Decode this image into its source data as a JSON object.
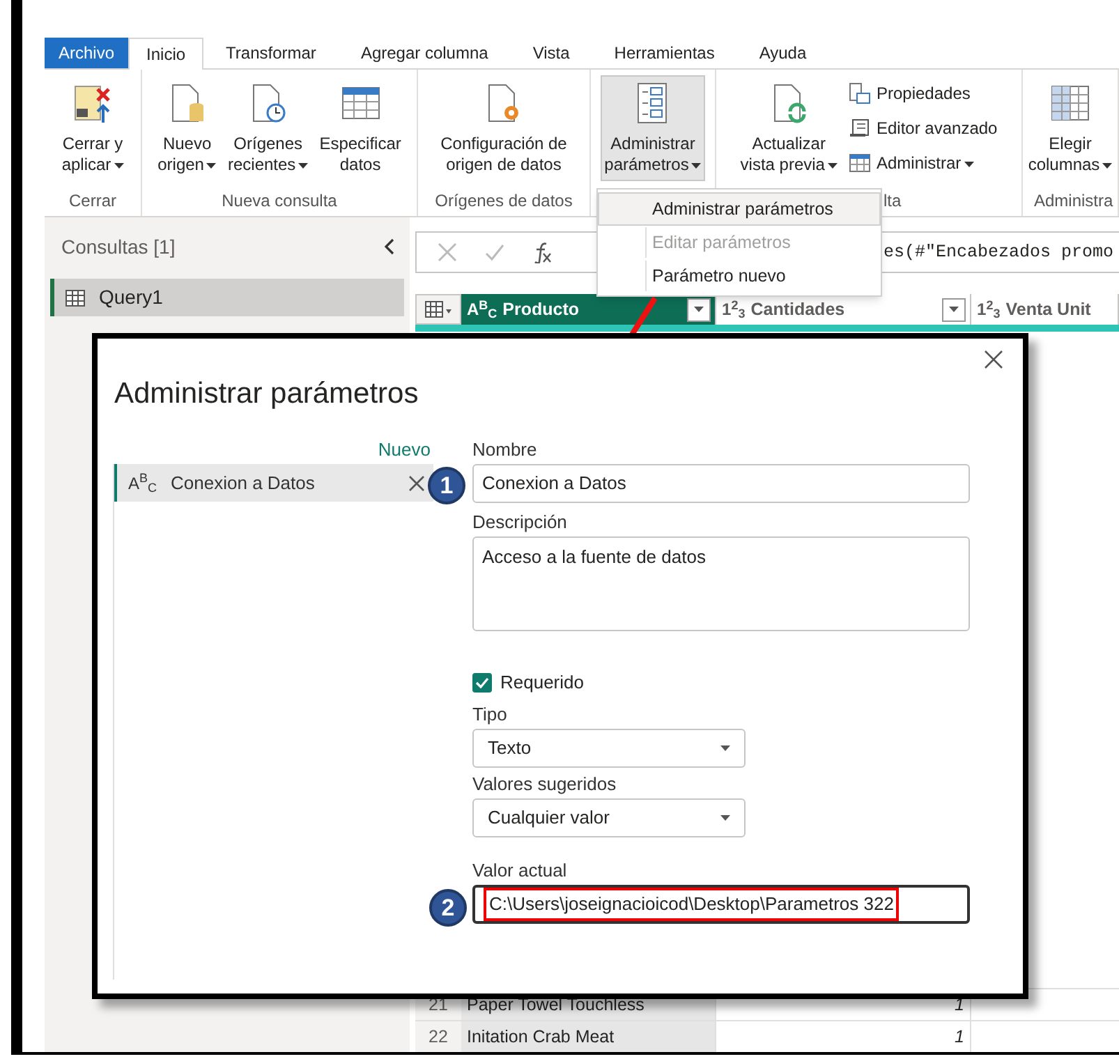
{
  "tabs": [
    {
      "label": "Archivo",
      "kind": "file",
      "selected": false
    },
    {
      "label": "Inicio",
      "kind": "tab",
      "selected": true
    },
    {
      "label": "Transformar",
      "kind": "tab",
      "selected": false
    },
    {
      "label": "Agregar columna",
      "kind": "tab",
      "selected": false
    },
    {
      "label": "Vista",
      "kind": "tab",
      "selected": false
    },
    {
      "label": "Herramientas",
      "kind": "tab",
      "selected": false
    },
    {
      "label": "Ayuda",
      "kind": "tab",
      "selected": false
    }
  ],
  "ribbon": {
    "groups": [
      {
        "label": "Cerrar",
        "buttons": [
          {
            "kind": "large",
            "label": "Cerrar y\naplicar",
            "caret": true,
            "pressed": false
          }
        ]
      },
      {
        "label": "Nueva consulta",
        "buttons": [
          {
            "kind": "large",
            "label": "Nuevo\norigen",
            "caret": true,
            "pressed": false
          },
          {
            "kind": "large",
            "label": "Orígenes\nrecientes",
            "caret": true,
            "pressed": false
          },
          {
            "kind": "large",
            "label": "Especificar\ndatos",
            "caret": false,
            "pressed": false
          }
        ]
      },
      {
        "label": "Orígenes de datos",
        "buttons": [
          {
            "kind": "large",
            "label": "Configuración de\norigen de datos",
            "caret": false,
            "pressed": false
          }
        ]
      },
      {
        "buttons": [
          {
            "kind": "large",
            "label": "Administrar\nparámetros",
            "caret": true,
            "pressed": true
          }
        ]
      },
      {
        "label": "lta",
        "buttons": [
          {
            "kind": "large",
            "label": "Actualizar\nvista previa",
            "caret": true,
            "pressed": false
          },
          {
            "kind": "small",
            "label": "Propiedades",
            "caret": false,
            "pressed": false
          },
          {
            "kind": "small",
            "label": "Editor avanzado",
            "caret": false,
            "pressed": false
          },
          {
            "kind": "small",
            "label": "Administrar",
            "caret": true,
            "pressed": false
          }
        ]
      },
      {
        "label": "Administra",
        "buttons": [
          {
            "kind": "large",
            "label": "Elegir\ncolumnas",
            "caret": true,
            "pressed": false
          }
        ]
      }
    ]
  },
  "queries_pane": {
    "title": "Consultas [1]",
    "items": [
      {
        "name": "Query1",
        "selected": true
      }
    ]
  },
  "formula_bar": {
    "text": "es(#\"Encabezados promo"
  },
  "table": {
    "columns": [
      {
        "type_label": "A$^{B}$$_{C}$",
        "name": "Producto",
        "selected": true
      },
      {
        "type_label": "1$^{2}$$_{3}$",
        "name": "Cantidades",
        "selected": false
      },
      {
        "type_label": "1$^{2}$$_{3}$",
        "name": "Venta Unit",
        "selected": false
      }
    ],
    "rows": [
      {
        "number": "21",
        "cells": [
          "Paper Towel Touchless",
          "1"
        ]
      },
      {
        "number": "22",
        "cells": [
          "Initation Crab Meat",
          "1"
        ]
      }
    ]
  },
  "menu": {
    "items": [
      {
        "label": "Administrar parámetros",
        "selected": true,
        "disabled": false
      },
      {
        "label": "Editar parámetros",
        "selected": false,
        "disabled": true
      },
      {
        "label": "Parámetro nuevo",
        "selected": false,
        "disabled": false
      }
    ]
  },
  "dialog": {
    "title": "Administrar parámetros",
    "new_link": "Nuevo",
    "parameters": [
      {
        "type_label": "A$^{B}$$_{C}$",
        "name": "Conexion a Datos",
        "selected": true
      }
    ],
    "fields": [
      {
        "kind": "text",
        "label": "Nombre",
        "value": "Conexion a Datos",
        "badge": "1",
        "highlighted": false
      },
      {
        "kind": "textarea",
        "label": "Descripción",
        "value": "Acceso a la fuente de datos"
      },
      {
        "kind": "checkbox",
        "label": "Requerido",
        "checked": true
      },
      {
        "kind": "select",
        "label": "Tipo",
        "value": "Texto"
      },
      {
        "kind": "select",
        "label": "Valores sugeridos",
        "value": "Cualquier valor"
      },
      {
        "kind": "text",
        "label": "Valor actual",
        "value": "C:\\Users\\joseignacioicod\\Desktop\\Parametros 322",
        "badge": "2",
        "highlighted": true
      }
    ]
  }
}
